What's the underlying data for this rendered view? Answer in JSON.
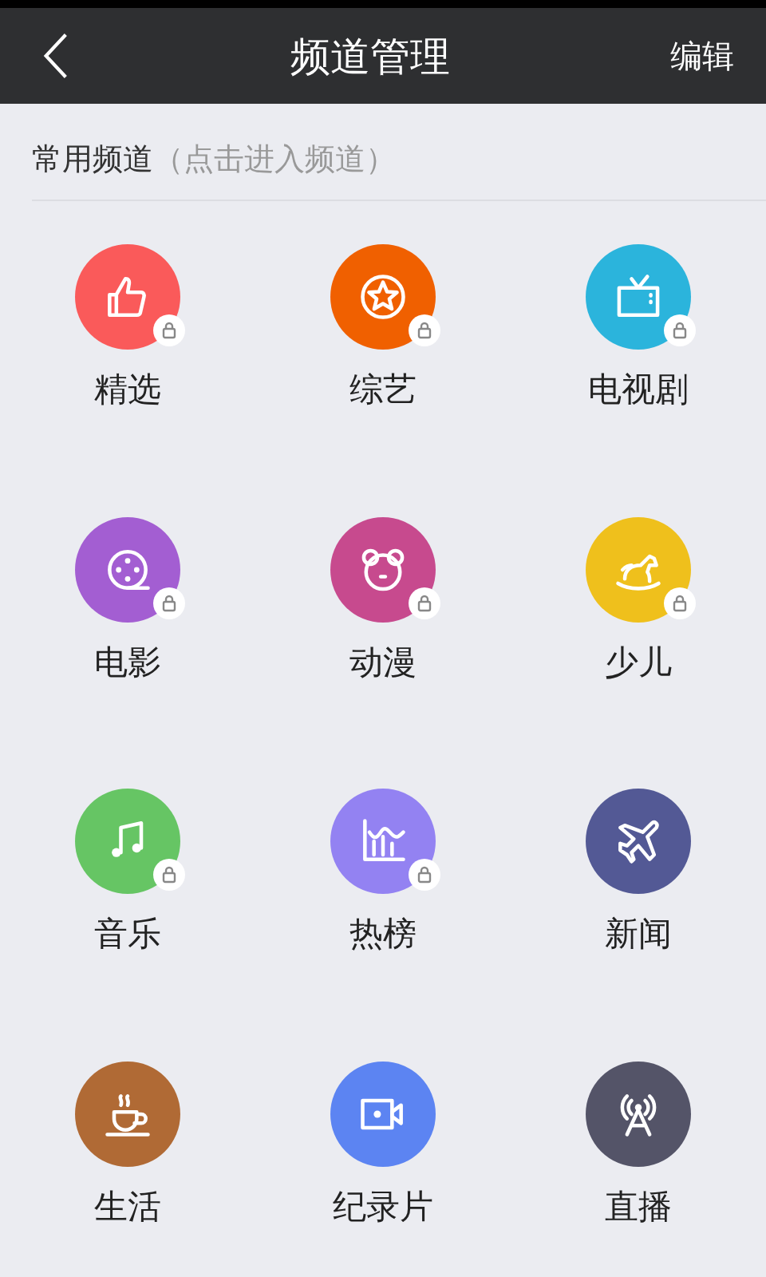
{
  "header": {
    "title": "频道管理",
    "action": "编辑"
  },
  "section": {
    "title": "常用频道",
    "hint": "（点击进入频道）"
  },
  "channels": [
    {
      "label": "精选",
      "color": "#fa5a5a",
      "locked": true
    },
    {
      "label": "综艺",
      "color": "#f06000",
      "locked": true
    },
    {
      "label": "电视剧",
      "color": "#2bb4dc",
      "locked": true
    },
    {
      "label": "电影",
      "color": "#a35ed2",
      "locked": true
    },
    {
      "label": "动漫",
      "color": "#c74a8e",
      "locked": true
    },
    {
      "label": "少儿",
      "color": "#efc01c",
      "locked": true
    },
    {
      "label": "音乐",
      "color": "#66c564",
      "locked": true
    },
    {
      "label": "热榜",
      "color": "#9382f2",
      "locked": true
    },
    {
      "label": "新闻",
      "color": "#535995",
      "locked": false
    },
    {
      "label": "生活",
      "color": "#b06a35",
      "locked": false
    },
    {
      "label": "纪录片",
      "color": "#5c84f2",
      "locked": false
    },
    {
      "label": "直播",
      "color": "#545468",
      "locked": false
    }
  ]
}
